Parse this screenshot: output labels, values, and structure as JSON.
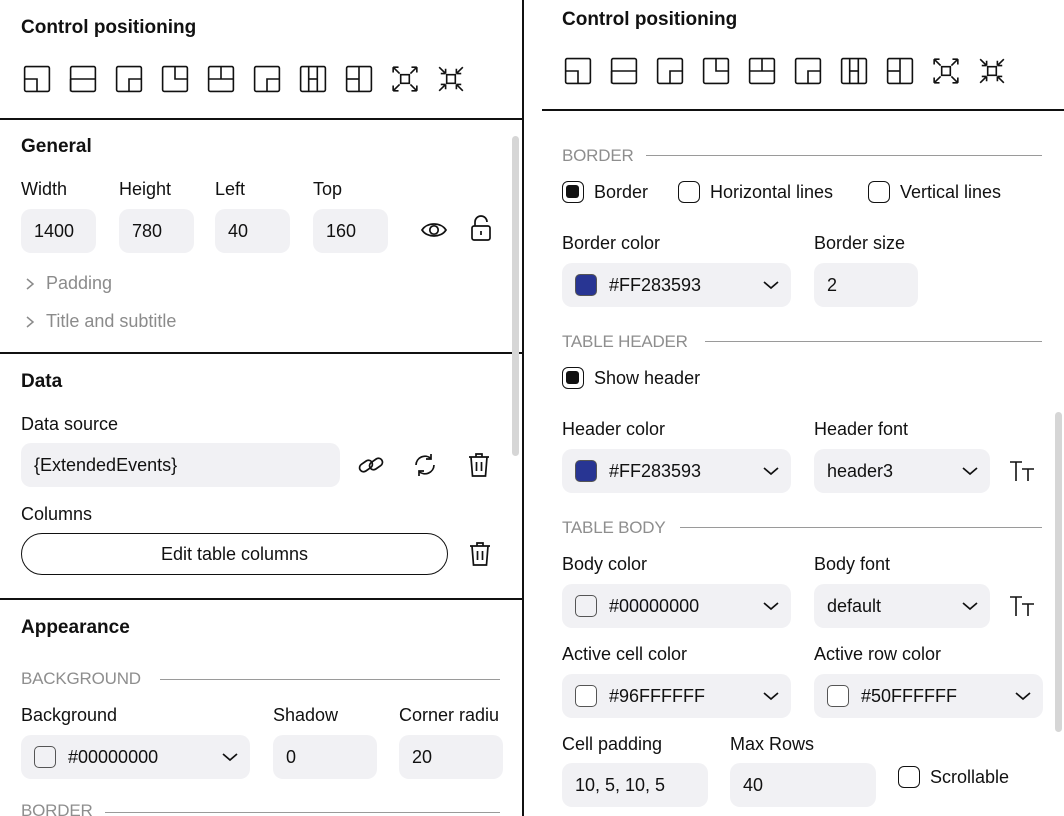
{
  "left": {
    "control_positioning": {
      "title": "Control positioning"
    },
    "general": {
      "title": "General",
      "width_label": "Width",
      "width_value": "1400",
      "height_label": "Height",
      "height_value": "780",
      "left_label": "Left",
      "left_value": "40",
      "top_label": "Top",
      "top_value": "160",
      "padding_label": "Padding",
      "title_subtitle_label": "Title and subtitle"
    },
    "data": {
      "title": "Data",
      "source_label": "Data source",
      "source_value": "{ExtendedEvents}",
      "columns_label": "Columns",
      "edit_columns_label": "Edit table columns"
    },
    "appearance": {
      "title": "Appearance",
      "background_section": "BACKGROUND",
      "background_label": "Background",
      "background_value": "#00000000",
      "shadow_label": "Shadow",
      "shadow_value": "0",
      "corner_label": "Corner radiu",
      "corner_value": "20",
      "border_section": "BORDER"
    }
  },
  "right": {
    "control_positioning": {
      "title": "Control positioning"
    },
    "border": {
      "section": "BORDER",
      "border_check": "Border",
      "horizontal_check": "Horizontal lines",
      "vertical_check": "Vertical lines",
      "border_color_label": "Border color",
      "border_color_value": "#FF283593",
      "border_size_label": "Border size",
      "border_size_value": "2"
    },
    "table_header": {
      "section": "TABLE HEADER",
      "show_header": "Show header",
      "header_color_label": "Header color",
      "header_color_value": "#FF283593",
      "header_font_label": "Header font",
      "header_font_value": "header3"
    },
    "table_body": {
      "section": "TABLE BODY",
      "body_color_label": "Body color",
      "body_color_value": "#00000000",
      "body_font_label": "Body font",
      "body_font_value": "default",
      "active_cell_label": "Active cell color",
      "active_cell_value": "#96FFFFFF",
      "active_row_label": "Active row color",
      "active_row_value": "#50FFFFFF",
      "cell_padding_label": "Cell padding",
      "cell_padding_value": "10, 5, 10, 5",
      "max_rows_label": "Max Rows",
      "max_rows_value": "40",
      "scrollable_label": "Scrollable"
    }
  },
  "colors": {
    "accent_navy": "#283593",
    "field_bg": "#f1f1f4",
    "section_gray": "#8e8e8e"
  },
  "icons": {
    "positioning": [
      "dock-top-left-icon",
      "dock-top-icon",
      "dock-top-right-icon",
      "dock-left-icon",
      "dock-center-icon",
      "dock-right-icon",
      "dock-bottom-left-icon",
      "dock-bottom-icon",
      "expand-icon",
      "shrink-icon"
    ],
    "visibility": "eye-icon",
    "lock": "unlock-icon",
    "link": "link-icon",
    "refresh": "refresh-icon",
    "delete": "trash-icon",
    "font": "font-size-icon",
    "chevron": "chevron-down-icon"
  }
}
